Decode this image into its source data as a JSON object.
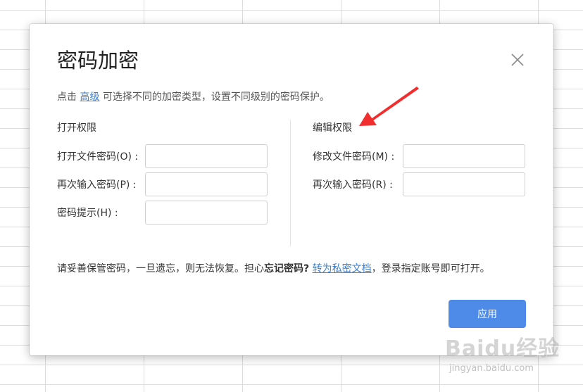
{
  "dialog": {
    "title": "密码加密",
    "close_icon": "close-icon",
    "hint": {
      "prefix": "点击 ",
      "link": "高级",
      "suffix": " 可选择不同的加密类型，设置不同级别的密码保护。"
    },
    "open_section": {
      "title": "打开权限",
      "fields": [
        {
          "label": "打开文件密码(O) :",
          "value": "",
          "placeholder": ""
        },
        {
          "label": "再次输入密码(P) :",
          "value": "",
          "placeholder": ""
        },
        {
          "label": "密码提示(H) :",
          "value": "",
          "placeholder": ""
        }
      ]
    },
    "edit_section": {
      "title": "编辑权限",
      "fields": [
        {
          "label": "修改文件密码(M) :",
          "value": "",
          "placeholder": ""
        },
        {
          "label": "再次输入密码(R) :",
          "value": "",
          "placeholder": ""
        }
      ]
    },
    "bottom_note": {
      "prefix": "请妥善保管密码，一旦遗忘，则无法恢复。担心",
      "bold": "忘记密码?",
      "link": "转为私密文档",
      "suffix": "，登录指定账号即可打开。"
    },
    "apply_button": "应用"
  },
  "annotation": {
    "arrow_icon": "red-arrow-icon",
    "color": "#f22d2d"
  },
  "watermark": {
    "brand": "Baidu经验",
    "url": "jingyan.baidu.com"
  },
  "colors": {
    "accent": "#4e8be8",
    "link": "#3b7fd4"
  }
}
